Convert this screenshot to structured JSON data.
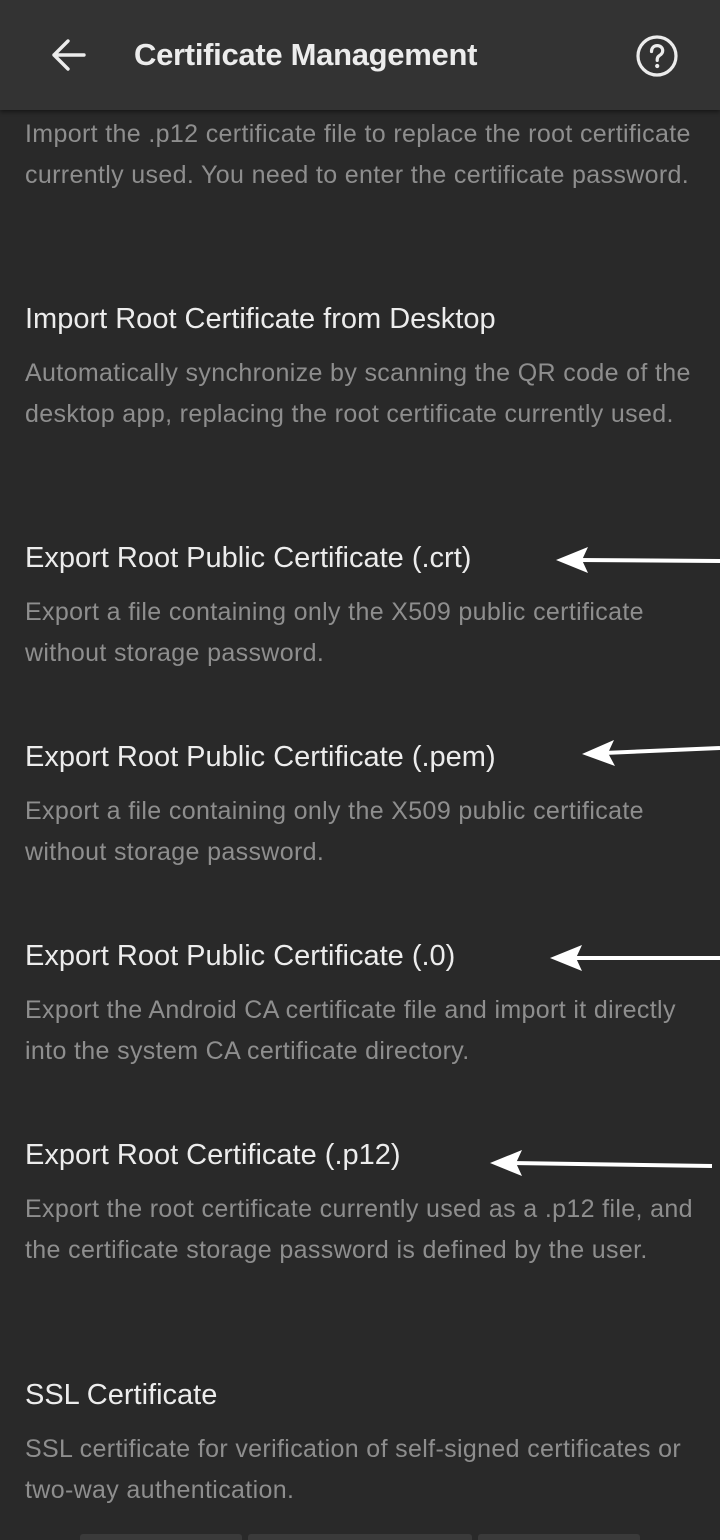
{
  "header": {
    "title": "Certificate Management",
    "back_icon": "arrow-left-icon",
    "help_icon": "help-circle-icon"
  },
  "partial_item": {
    "description": "Import the .p12 certificate file to replace the root certificate currently used. You need to enter the certificate password."
  },
  "items": [
    {
      "title": "Import Root Certificate from Desktop",
      "description": "Automatically synchronize by scanning the QR code of the desktop app, replacing the root certificate currently used."
    },
    {
      "title": "Export Root Public Certificate (.crt)",
      "description": "Export a file containing only the X509 public certificate without storage password."
    },
    {
      "title": "Export Root Public Certificate (.pem)",
      "description": "Export a file containing only the X509 public certificate without storage password."
    },
    {
      "title": "Export Root Public Certificate (.0)",
      "description": "Export the Android CA certificate file and import it directly into the system CA certificate directory."
    },
    {
      "title": "Export Root Certificate (.p12)",
      "description": "Export the root certificate currently used as a .p12 file, and the certificate storage password is defined by the user."
    },
    {
      "title": "SSL Certificate",
      "description": "SSL certificate for verification of self-signed certificates or two-way authentication."
    }
  ],
  "colors": {
    "background": "#292929",
    "appbar": "#333333",
    "title_text": "#ececec",
    "secondary_text": "#8e8e8e",
    "annotation_arrow": "#ffffff"
  }
}
